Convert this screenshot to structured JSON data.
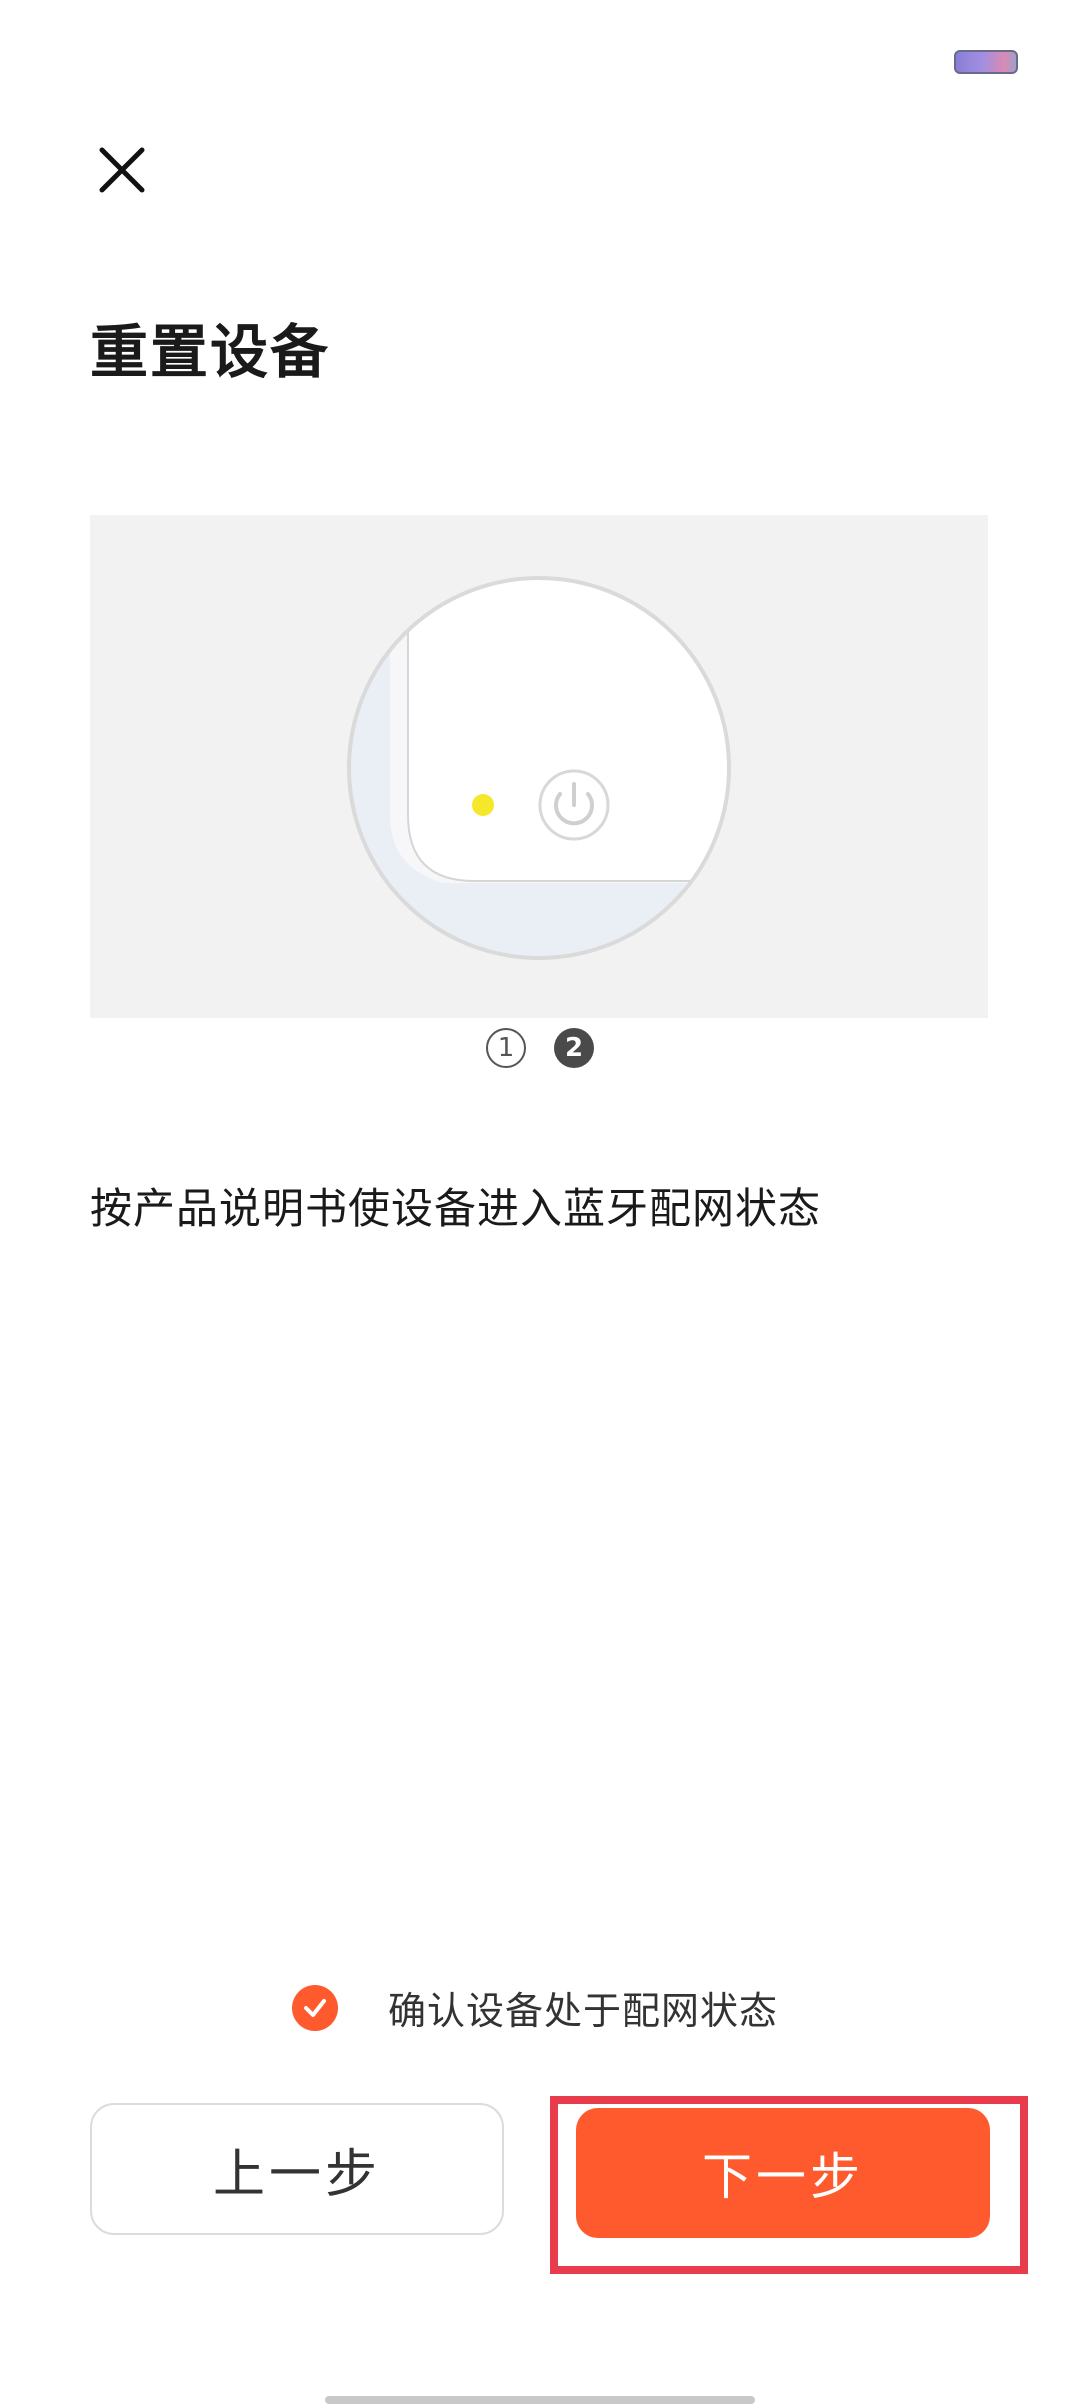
{
  "header": {
    "close_icon": "close-icon",
    "title": "重置设备"
  },
  "illustration": {
    "icon": "power-button-icon",
    "led_color": "#f5e82a"
  },
  "pager": {
    "pages": [
      "1",
      "2"
    ],
    "active_index": 1
  },
  "instruction": "按产品说明书使设备进入蓝牙配网状态",
  "confirm": {
    "checked": true,
    "label": "确认设备处于配网状态",
    "icon": "check-circle-icon"
  },
  "buttons": {
    "prev_label": "上一步",
    "next_label": "下一步"
  },
  "colors": {
    "accent": "#fe5a2d",
    "highlight": "#e83b4c"
  }
}
